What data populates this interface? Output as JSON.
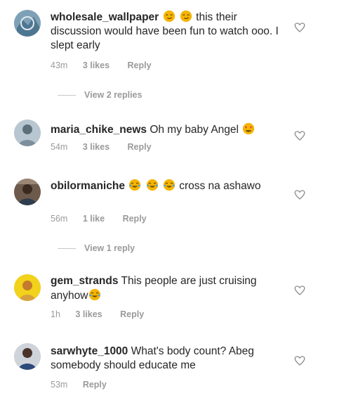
{
  "comments": [
    {
      "username": "wholesale_wallpaper",
      "emoji_before": "😏😏",
      "text": "this their discussion would have been fun to watch ooo. I slept early",
      "time": "43m",
      "likes": "3 likes",
      "reply": "Reply",
      "view_replies": "View 2 replies"
    },
    {
      "username": "maria_chike_news",
      "text": "Oh my baby Angel",
      "emoji_after": "😍",
      "time": "54m",
      "likes": "3 likes",
      "reply": "Reply"
    },
    {
      "username": "obilormaniche",
      "emoji_mid": "😂😂😂",
      "text": "cross na ashawo",
      "time": "56m",
      "likes": "1 like",
      "reply": "Reply",
      "view_replies": "View 1 reply"
    },
    {
      "username": "gem_strands",
      "text": "This people are just cruising anyhow",
      "emoji_after": "😂",
      "time": "1h",
      "likes": "3 likes",
      "reply": "Reply"
    },
    {
      "username": "sarwhyte_1000",
      "text": "What's body count? Abeg somebody should educate me",
      "time": "53m",
      "reply": "Reply"
    }
  ],
  "icons": {
    "heart": "heart-outline-icon",
    "emoji_smirk": "smirk-emoji-icon",
    "emoji_heart_eyes": "heart-eyes-emoji-icon",
    "emoji_laugh": "tears-of-joy-emoji-icon"
  },
  "colors": {
    "text": "#262626",
    "meta": "#9a9a9a",
    "emoji": "#f5b400"
  }
}
